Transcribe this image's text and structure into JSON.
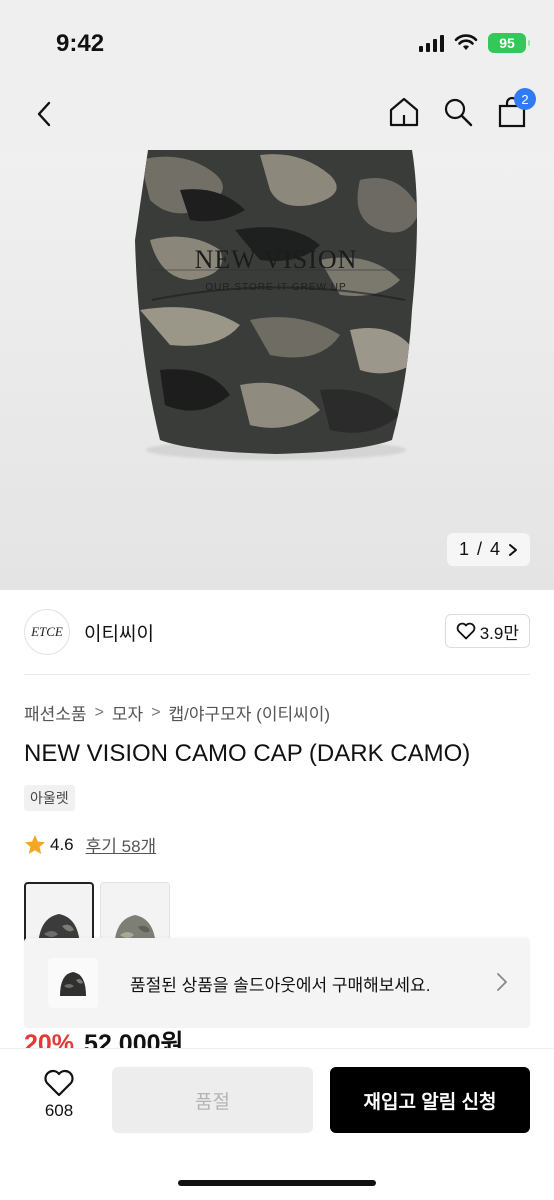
{
  "status_bar": {
    "time": "9:42",
    "battery": "95"
  },
  "nav": {
    "cart_count": "2"
  },
  "gallery": {
    "current": "1",
    "separator": "/",
    "total": "4",
    "print_text": "NEW VISION",
    "print_subtext": "OUR STORE IT GREW UP"
  },
  "brand": {
    "logo_text": "ETCE",
    "name": "이티씨이",
    "likes": "3.9만"
  },
  "breadcrumb": {
    "items": [
      "패션소품",
      "모자",
      "캡/야구모자 (이티씨이)"
    ],
    "separator": ">"
  },
  "product": {
    "title": "NEW VISION CAMO CAP (DARK CAMO)",
    "tag": "아울렛",
    "rating": "4.6",
    "review_label": "후기 58개",
    "discount": "20%",
    "price": "52,000원"
  },
  "thumbnails": {
    "colors": [
      "dark camo",
      "light camo"
    ]
  },
  "soldout_banner": {
    "text": "품절된 상품을 솔드아웃에서 구매해보세요."
  },
  "bottom_bar": {
    "wish_count": "608",
    "soldout_label": "품절",
    "restock_label": "재입고 알림 신청"
  },
  "colors": {
    "accent_blue": "#2f7bf5",
    "discount_red": "#e53935",
    "star": "#f5a623",
    "battery_green": "#34c759"
  }
}
